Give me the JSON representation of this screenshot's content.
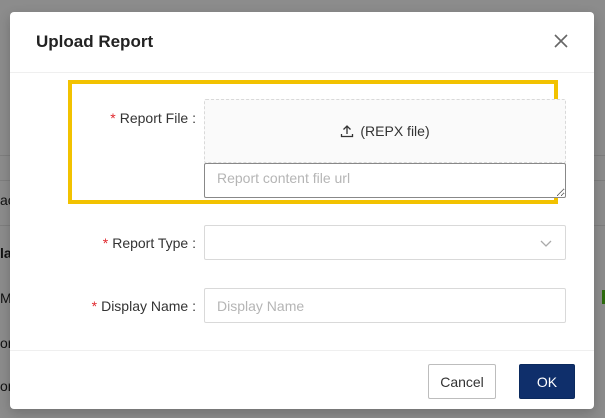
{
  "dialog": {
    "title": "Upload Report",
    "close_icon": "close-icon"
  },
  "form": {
    "report_file": {
      "required_mark": "*",
      "label": "Report File :",
      "upload_text": "(REPX file)",
      "upload_icon": "upload-icon",
      "url_placeholder": "Report content file url",
      "url_value": ""
    },
    "report_type": {
      "required_mark": "*",
      "label": "Report Type :",
      "value": "",
      "chevron_icon": "chevron-down-icon"
    },
    "display_name": {
      "required_mark": "*",
      "label": "Display Name :",
      "placeholder": "Display Name",
      "value": ""
    }
  },
  "footer": {
    "cancel_label": "Cancel",
    "ok_label": "OK"
  },
  "background": {
    "fragments": [
      "ac",
      "la",
      "Mo",
      "on",
      "on"
    ]
  },
  "colors": {
    "highlight": "#f2c200",
    "primary": "#0f2f6b",
    "required": "#e0282e"
  }
}
